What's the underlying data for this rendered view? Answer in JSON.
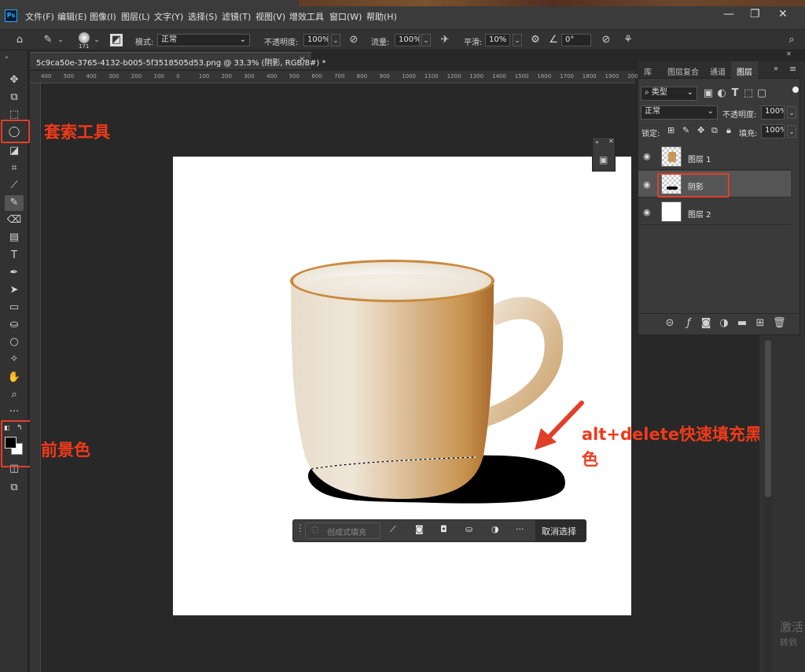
{
  "app": {
    "logo_text": "Ps",
    "menu": [
      "文件(F)",
      "编辑(E)",
      "图像(I)",
      "图层(L)",
      "文字(Y)",
      "选择(S)",
      "滤镜(T)",
      "视图(V)",
      "增效工具",
      "窗口(W)",
      "帮助(H)"
    ],
    "window_controls": [
      "—",
      "❐",
      "✕"
    ]
  },
  "options_bar": {
    "brush_size": "171",
    "mode_label": "模式:",
    "mode_value": "正常",
    "opacity_label": "不透明度:",
    "opacity_value": "100%",
    "flow_label": "流量:",
    "flow_value": "100%",
    "smooth_label": "平滑:",
    "smooth_value": "10%",
    "angle_value": "0°"
  },
  "document": {
    "tab_title": "5c9ca50e-3765-4132-b005-5f3518505d53.png @ 33.3% (阴影, RGB/8#) *",
    "tab_close": "×",
    "ruler_ticks": [
      "400",
      "500",
      "400",
      "300",
      "200",
      "100",
      "0",
      "100",
      "200",
      "300",
      "400",
      "500",
      "600",
      "700",
      "800",
      "900",
      "1000",
      "1100",
      "1200",
      "1300",
      "1400",
      "1500",
      "1600",
      "1700",
      "1800",
      "1900",
      "2000",
      "2100"
    ]
  },
  "annotations": {
    "lasso": "套索工具",
    "foreground": "前景色",
    "shortcut_line1": "alt+delete快速填充黑",
    "shortcut_line2": "色"
  },
  "layers_panel": {
    "tabs": [
      "库",
      "图层复合",
      "通道",
      "图层"
    ],
    "filter_label": "类型",
    "blend_mode": "正常",
    "opacity_label": "不透明度:",
    "opacity_value": "100%",
    "lock_label": "锁定:",
    "fill_label": "填充:",
    "fill_value": "100%",
    "layers": [
      {
        "name": "图层 1",
        "selected": false
      },
      {
        "name": "阴影",
        "selected": true
      },
      {
        "name": "图层 2",
        "selected": false
      }
    ]
  },
  "context_bar": {
    "generative_fill": "创成式填充",
    "deselect": "取消选择",
    "more": "···"
  },
  "watermark": {
    "line1": "激活",
    "line2": "转到"
  },
  "colors": {
    "accent_red": "#e0402a",
    "foreground": "#000000",
    "background": "#ffffff"
  }
}
